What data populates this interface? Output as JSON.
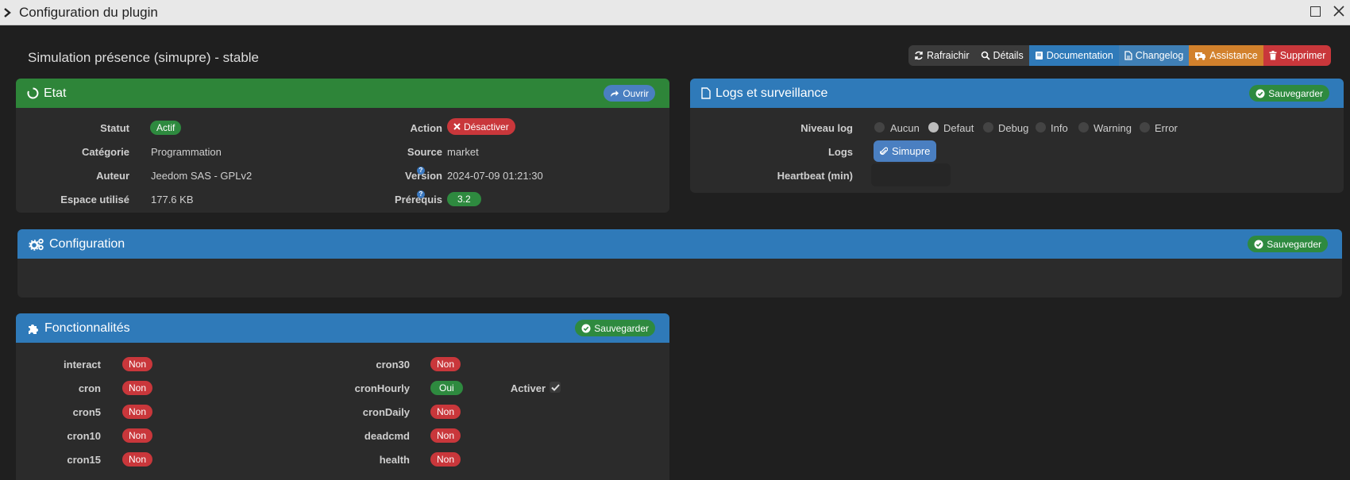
{
  "window": {
    "title": "Configuration du plugin"
  },
  "page": {
    "title": "Simulation présence (simupre) - stable"
  },
  "toolbar": {
    "refresh": "Rafraichir",
    "details": "Détails",
    "documentation": "Documentation",
    "changelog": "Changelog",
    "assistance": "Assistance",
    "delete": "Supprimer"
  },
  "etat": {
    "title": "Etat",
    "open_label": "Ouvrir",
    "statut_label": "Statut",
    "statut_value": "Actif",
    "categorie_label": "Catégorie",
    "categorie_value": "Programmation",
    "auteur_label": "Auteur",
    "auteur_value": "Jeedom SAS - GPLv2",
    "espace_label": "Espace utilisé",
    "espace_value": "177.6 KB",
    "action_label": "Action",
    "action_value": "Désactiver",
    "source_label": "Source",
    "source_value": "market",
    "version_label": "Version",
    "version_value": "2024-07-09 01:21:30",
    "prerequis_label": "Prérequis",
    "prerequis_value": "3.2"
  },
  "logs": {
    "title": "Logs et surveillance",
    "save_label": "Sauvegarder",
    "niveau_label": "Niveau log",
    "levels": [
      "Aucun",
      "Defaut",
      "Debug",
      "Info",
      "Warning",
      "Error"
    ],
    "selected_level": "Defaut",
    "logs_label": "Logs",
    "log_button": "Simupre",
    "heartbeat_label": "Heartbeat (min)",
    "heartbeat_value": ""
  },
  "configuration": {
    "title": "Configuration",
    "save_label": "Sauvegarder"
  },
  "fonctionnalites": {
    "title": "Fonctionnalités",
    "save_label": "Sauvegarder",
    "left": [
      {
        "name": "interact",
        "value": "Non"
      },
      {
        "name": "cron",
        "value": "Non"
      },
      {
        "name": "cron5",
        "value": "Non"
      },
      {
        "name": "cron10",
        "value": "Non"
      },
      {
        "name": "cron15",
        "value": "Non"
      }
    ],
    "right": [
      {
        "name": "cron30",
        "value": "Non"
      },
      {
        "name": "cronHourly",
        "value": "Oui"
      },
      {
        "name": "cronDaily",
        "value": "Non"
      },
      {
        "name": "deadcmd",
        "value": "Non"
      },
      {
        "name": "health",
        "value": "Non"
      }
    ],
    "activer_label": "Activer",
    "activer_checked": true
  },
  "colors": {
    "green": "#2e8539",
    "blue": "#2f7ab9",
    "red": "#c9373b",
    "orange": "#d2812c"
  }
}
